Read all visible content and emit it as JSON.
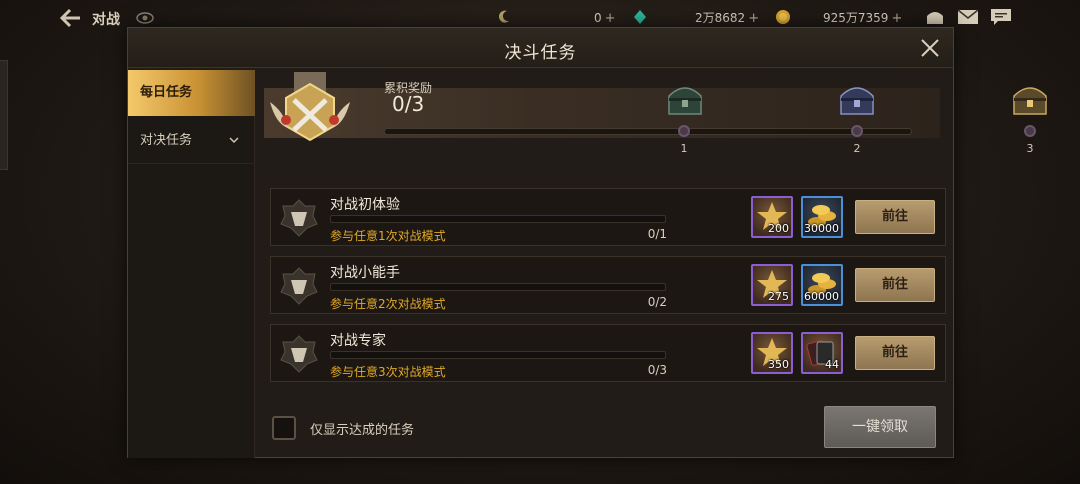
{
  "topbar": {
    "title": "对战",
    "currency_a": "0",
    "currency_b": "2万8682",
    "currency_c": "925万7359",
    "plus": "+"
  },
  "dialog": {
    "title": "决斗任务",
    "tabs": [
      {
        "label": "每日任务",
        "active": true
      },
      {
        "label": "对决任务",
        "active": false
      }
    ],
    "reward_track": {
      "label": "累积奖励",
      "progress": "0/3",
      "progress_fraction": 0,
      "milestones": [
        "1",
        "2",
        "3"
      ]
    },
    "tasks": [
      {
        "name": "对战初体验",
        "desc": "参与任意1次对战模式",
        "progress": "0/1",
        "progress_fraction": 0,
        "rewards": [
          {
            "type": "purple",
            "icon": "honor-badge-icon",
            "qty": "200"
          },
          {
            "type": "blue",
            "icon": "gold-coins-icon",
            "qty": "30000"
          }
        ],
        "button": "前往"
      },
      {
        "name": "对战小能手",
        "desc": "参与任意2次对战模式",
        "progress": "0/2",
        "progress_fraction": 0,
        "rewards": [
          {
            "type": "purple",
            "icon": "honor-badge-icon",
            "qty": "275"
          },
          {
            "type": "blue",
            "icon": "gold-coins-icon",
            "qty": "60000"
          }
        ],
        "button": "前往"
      },
      {
        "name": "对战专家",
        "desc": "参与任意3次对战模式",
        "progress": "0/3",
        "progress_fraction": 0,
        "rewards": [
          {
            "type": "purple",
            "icon": "honor-badge-icon",
            "qty": "350"
          },
          {
            "type": "purple",
            "icon": "card-pack-icon",
            "qty": "44"
          }
        ],
        "button": "前往"
      }
    ],
    "filter_label": "仅显示达成的任务",
    "claim_all": "一键领取"
  },
  "colors": {
    "accent_gold": "#e0a92a",
    "tab_active": "#c99234",
    "purple_frame": "#8b5fd1",
    "blue_frame": "#4a8fd8"
  }
}
